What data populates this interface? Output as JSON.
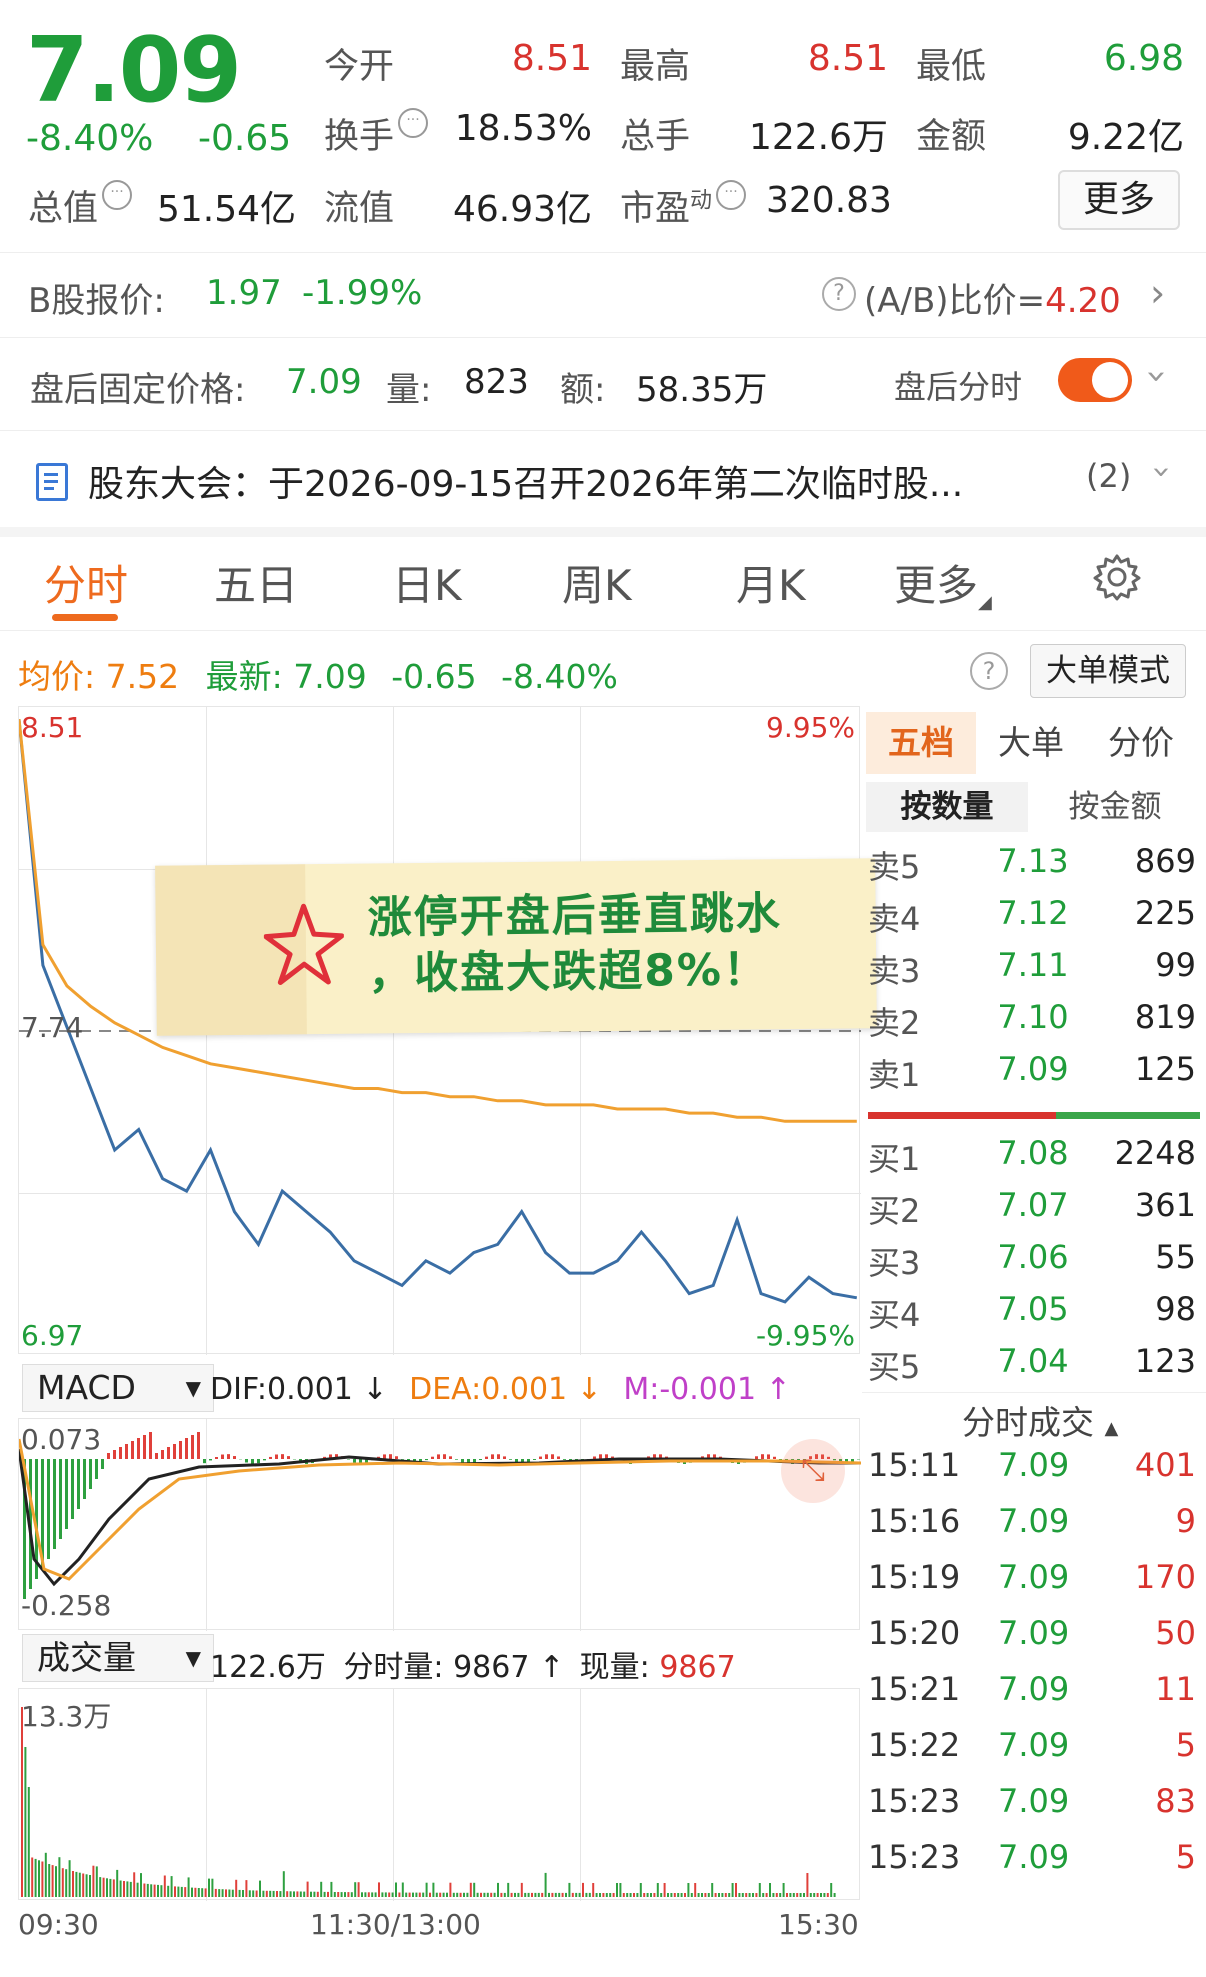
{
  "quote": {
    "price": "7.09",
    "change_pct": "-8.40%",
    "change_abs": "-0.65",
    "open_label": "今开",
    "open_value": "8.51",
    "high_label": "最高",
    "high_value": "8.51",
    "low_label": "最低",
    "low_value": "6.98",
    "turnover_label": "换手",
    "turnover_value": "18.53%",
    "volume_label": "总手",
    "volume_value": "122.6万",
    "amount_label": "金额",
    "amount_value": "9.22亿",
    "mktcap_label": "总值",
    "mktcap_value": "51.54亿",
    "float_label": "流值",
    "float_value": "46.93亿",
    "pe_label": "市盈",
    "pe_sup": "动",
    "pe_value": "320.83",
    "more_button": "更多"
  },
  "bshare": {
    "label": "B股报价:",
    "price": "1.97",
    "change": "-1.99%",
    "ratio_label": "(A/B)比价=",
    "ratio_value": "4.20"
  },
  "afterhours": {
    "label": "盘后固定价格:",
    "price": "7.09",
    "vol_label": "量:",
    "vol_value": "823",
    "amt_label": "额:",
    "amt_value": "58.35万",
    "timeshare_label": "盘后分时"
  },
  "notice": {
    "text": "股东大会：于2026-09-15召开2026年第二次临时股...",
    "count": "(2)"
  },
  "tabs": [
    "分时",
    "五日",
    "日K",
    "周K",
    "月K",
    "更多"
  ],
  "chart_header": {
    "avg_label": "均价:",
    "avg_value": "7.52",
    "latest_label": "最新:",
    "latest_value": "7.09",
    "chg": "-0.65",
    "pct": "-8.40%",
    "mode_button": "大单模式"
  },
  "chart_data": {
    "type": "line",
    "ylim": [
      6.97,
      8.51
    ],
    "y_top_label": "8.51",
    "y_mid_label": "7.74",
    "y_bottom_label": "6.97",
    "pct_top": "9.95%",
    "pct_bottom": "-9.95%",
    "x_labels": [
      "09:30",
      "11:30/13:00",
      "15:30"
    ],
    "series": [
      {
        "values": [
          8.5,
          7.9,
          7.75,
          7.6,
          7.45,
          7.5,
          7.38,
          7.35,
          7.45,
          7.3,
          7.22,
          7.35,
          7.3,
          7.25,
          7.18,
          7.15,
          7.12,
          7.18,
          7.15,
          7.2,
          7.22,
          7.3,
          7.2,
          7.15,
          7.15,
          7.18,
          7.25,
          7.18,
          7.1,
          7.12,
          7.28,
          7.1,
          7.08,
          7.14,
          7.1,
          7.09
        ]
      },
      {
        "values": [
          8.5,
          7.95,
          7.85,
          7.8,
          7.76,
          7.73,
          7.7,
          7.68,
          7.66,
          7.65,
          7.64,
          7.63,
          7.62,
          7.61,
          7.6,
          7.6,
          7.59,
          7.59,
          7.58,
          7.58,
          7.57,
          7.57,
          7.56,
          7.56,
          7.56,
          7.55,
          7.55,
          7.55,
          7.54,
          7.54,
          7.53,
          7.53,
          7.52,
          7.52,
          7.52,
          7.52
        ]
      }
    ]
  },
  "macd": {
    "selector": "MACD",
    "dif": "DIF:0.001",
    "dea": "DEA:0.001",
    "m": "M:-0.001",
    "top_label": "0.073",
    "bottom_label": "-0.258"
  },
  "volume": {
    "selector": "成交量",
    "summary_total": "122.6万",
    "summary_tick_label": "分时量:",
    "summary_tick_value": "9867",
    "summary_now_label": "现量:",
    "summary_now_value": "9867",
    "max_label": "13.3万"
  },
  "orderbook": {
    "tabs": [
      "五档",
      "大单",
      "分价"
    ],
    "sub_tabs": [
      "按数量",
      "按金额"
    ],
    "asks": [
      {
        "label": "卖5",
        "price": "7.13",
        "vol": "869"
      },
      {
        "label": "卖4",
        "price": "7.12",
        "vol": "225"
      },
      {
        "label": "卖3",
        "price": "7.11",
        "vol": "99"
      },
      {
        "label": "卖2",
        "price": "7.10",
        "vol": "819"
      },
      {
        "label": "卖1",
        "price": "7.09",
        "vol": "125"
      }
    ],
    "bids": [
      {
        "label": "买1",
        "price": "7.08",
        "vol": "2248"
      },
      {
        "label": "买2",
        "price": "7.07",
        "vol": "361"
      },
      {
        "label": "买3",
        "price": "7.06",
        "vol": "55"
      },
      {
        "label": "买4",
        "price": "7.05",
        "vol": "98"
      },
      {
        "label": "买5",
        "price": "7.04",
        "vol": "123"
      }
    ],
    "ticks_title": "分时成交",
    "ticks": [
      {
        "time": "15:11",
        "price": "7.09",
        "vol": "401"
      },
      {
        "time": "15:16",
        "price": "7.09",
        "vol": "9"
      },
      {
        "time": "15:19",
        "price": "7.09",
        "vol": "170"
      },
      {
        "time": "15:20",
        "price": "7.09",
        "vol": "50"
      },
      {
        "time": "15:21",
        "price": "7.09",
        "vol": "11"
      },
      {
        "time": "15:22",
        "price": "7.09",
        "vol": "5"
      },
      {
        "time": "15:23",
        "price": "7.09",
        "vol": "83"
      },
      {
        "time": "15:23",
        "price": "7.09",
        "vol": "5"
      }
    ]
  },
  "sticker": {
    "line1": "涨停开盘后垂直跳水",
    "line2": "，收盘大跌超8%！"
  },
  "colors": {
    "up": "#d8332e",
    "down": "#1f9d3a",
    "accent": "#ee6a1e",
    "price_line": "#3a6ea5",
    "avg_line": "#f0a030"
  }
}
